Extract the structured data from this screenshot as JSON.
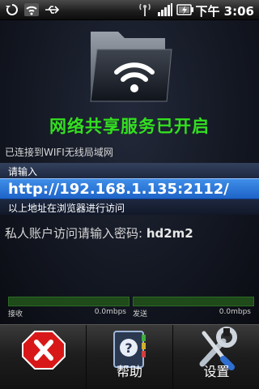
{
  "status_bar": {
    "time": "下午 3:06",
    "icons": [
      "sync-icon",
      "wifi-icon",
      "usb-icon",
      "broadcast-icon",
      "signal-icon",
      "battery-icon"
    ]
  },
  "main": {
    "status_title": "网络共享服务已开启",
    "connected_text": "已连接到WIFI无线局域网",
    "prompt_label": "请输入",
    "url": "http://192.168.1.135:2112/",
    "hint": "以上地址在浏览器进行访问",
    "password_label": "私人账户访问请输入密码: ",
    "password_value": "hd2m2"
  },
  "meters": {
    "receive_label": "接收",
    "receive_value": "0.0mbps",
    "receive_fraction": 0,
    "send_label": "发送",
    "send_value": "0.0mbps",
    "send_fraction": 0
  },
  "toolbar": {
    "buttons": [
      {
        "label": "",
        "icon": "close-icon"
      },
      {
        "label": "帮助",
        "icon": "help-book-icon"
      },
      {
        "label": "设置",
        "icon": "settings-tools-icon"
      }
    ]
  },
  "colors": {
    "accent_green": "#33e01f",
    "url_blue": "#2f7ae0"
  }
}
